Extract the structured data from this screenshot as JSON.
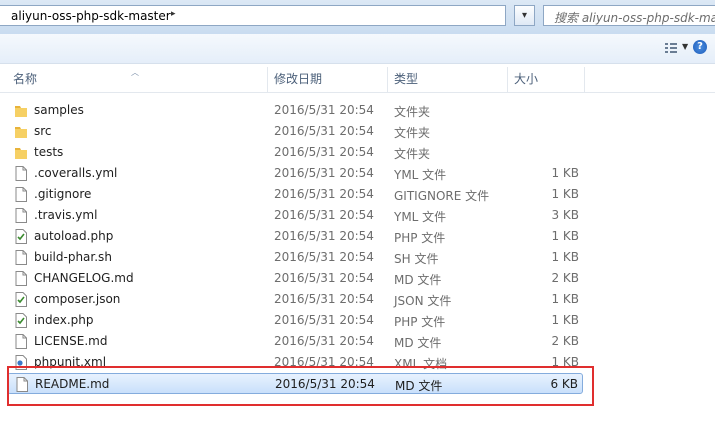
{
  "address": {
    "path": "aliyun-oss-php-sdk-master",
    "arrow": "▸"
  },
  "search": {
    "placeholder": "搜索 aliyun-oss-php-sdk-master"
  },
  "toolbar": {
    "help": "?"
  },
  "columns": {
    "name": "名称",
    "modified": "修改日期",
    "type": "类型",
    "size": "大小"
  },
  "files": [
    {
      "name": "samples",
      "date": "2016/5/31 20:54",
      "type": "文件夹",
      "size": "",
      "icon": "folder-icon"
    },
    {
      "name": "src",
      "date": "2016/5/31 20:54",
      "type": "文件夹",
      "size": "",
      "icon": "folder-icon"
    },
    {
      "name": "tests",
      "date": "2016/5/31 20:54",
      "type": "文件夹",
      "size": "",
      "icon": "folder-icon"
    },
    {
      "name": ".coveralls.yml",
      "date": "2016/5/31 20:54",
      "type": "YML 文件",
      "size": "1 KB",
      "icon": "file-icon"
    },
    {
      "name": ".gitignore",
      "date": "2016/5/31 20:54",
      "type": "GITIGNORE 文件",
      "size": "1 KB",
      "icon": "file-icon"
    },
    {
      "name": ".travis.yml",
      "date": "2016/5/31 20:54",
      "type": "YML 文件",
      "size": "3 KB",
      "icon": "file-icon"
    },
    {
      "name": "autoload.php",
      "date": "2016/5/31 20:54",
      "type": "PHP 文件",
      "size": "1 KB",
      "icon": "script-file-icon"
    },
    {
      "name": "build-phar.sh",
      "date": "2016/5/31 20:54",
      "type": "SH 文件",
      "size": "1 KB",
      "icon": "file-icon"
    },
    {
      "name": "CHANGELOG.md",
      "date": "2016/5/31 20:54",
      "type": "MD 文件",
      "size": "2 KB",
      "icon": "file-icon"
    },
    {
      "name": "composer.json",
      "date": "2016/5/31 20:54",
      "type": "JSON 文件",
      "size": "1 KB",
      "icon": "script-file-icon"
    },
    {
      "name": "index.php",
      "date": "2016/5/31 20:54",
      "type": "PHP 文件",
      "size": "1 KB",
      "icon": "script-file-icon"
    },
    {
      "name": "LICENSE.md",
      "date": "2016/5/31 20:54",
      "type": "MD 文件",
      "size": "2 KB",
      "icon": "file-icon"
    },
    {
      "name": "phpunit.xml",
      "date": "2016/5/31 20:54",
      "type": "XML 文档",
      "size": "1 KB",
      "icon": "xml-file-icon"
    },
    {
      "name": "README.md",
      "date": "2016/5/31 20:54",
      "type": "MD 文件",
      "size": "6 KB",
      "icon": "file-icon",
      "selected": true
    }
  ],
  "colors": {
    "highlight": "#e02e2e",
    "selection": "#c9e0fb",
    "folder": "#f0c24a"
  }
}
